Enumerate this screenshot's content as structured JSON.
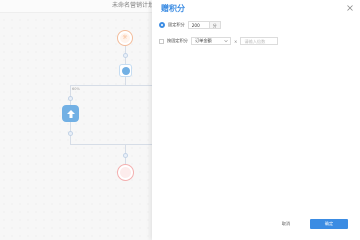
{
  "canvas": {
    "plan_title": "未命名营销计划",
    "branch_tag": "60%",
    "start_node": {
      "icon_text": "☼",
      "caption": "",
      "label_top": "",
      "label_main": ""
    },
    "action_node": {
      "label_top": "",
      "label_main": ""
    },
    "big_node": {
      "label_top": "",
      "label_main": ""
    },
    "end_node": {
      "icon_text": ""
    }
  },
  "drawer": {
    "title": "赠积分",
    "close_icon": "close-icon",
    "fixed_points": {
      "label": "固定积分",
      "value": "200",
      "unit": "分",
      "checked": true
    },
    "by_field": {
      "label": "按固定积分",
      "select_value": "订单金额",
      "multiply_sign": "×",
      "input_placeholder": "请输入倍数",
      "checked": false
    },
    "cancel_label": "取消",
    "ok_label": "确定"
  },
  "colors": {
    "accent": "#3b8ce3",
    "start": "#f07f36",
    "end": "#e05454",
    "node_blue": "#5aa3e0"
  }
}
